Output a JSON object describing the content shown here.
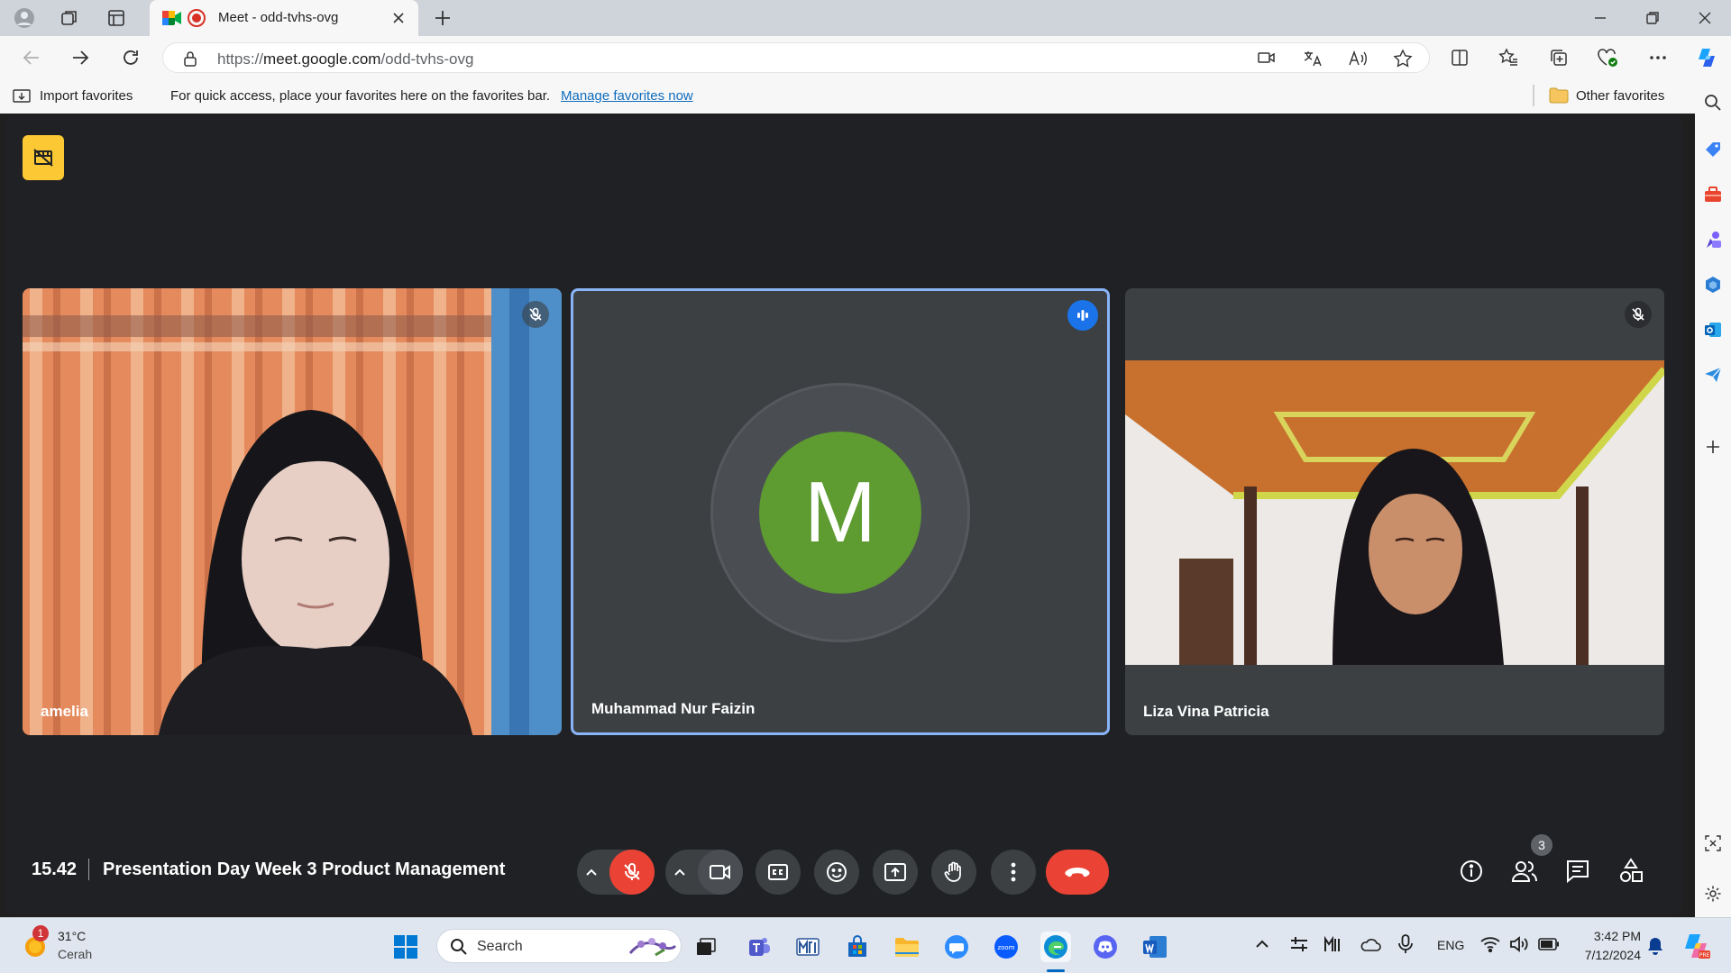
{
  "browser": {
    "tab_title": "Meet - odd-tvhs-ovg",
    "url_prefix": "https://",
    "url_domain": "meet.google.com",
    "url_path": "/odd-tvhs-ovg",
    "favorites_bar": {
      "import_label": "Import favorites",
      "hint": "For quick access, place your favorites here on the favorites bar.",
      "manage_link": "Manage favorites now",
      "other_label": "Other favorites"
    }
  },
  "meet": {
    "time": "15.42",
    "meeting_title": "Presentation Day Week 3 Product Management",
    "participant_count": "3",
    "participants": [
      {
        "name": "amelia",
        "muted": true
      },
      {
        "name": "Muhammad Nur Faizin",
        "avatar_letter": "M",
        "speaking": true,
        "avatar_color": "#5e9b31"
      },
      {
        "name": "Liza Vina Patricia",
        "muted": true
      }
    ],
    "colors": {
      "accent": "#8ab4f8",
      "end_call": "#ea4335",
      "mic_off": "#ea4335",
      "badge": "#fcc934"
    }
  },
  "taskbar": {
    "weather_temp": "31°C",
    "weather_desc": "Cerah",
    "weather_badge": "1",
    "search_placeholder": "Search",
    "language": "ENG",
    "clock_time": "3:42 PM",
    "clock_date": "7/12/2024"
  }
}
